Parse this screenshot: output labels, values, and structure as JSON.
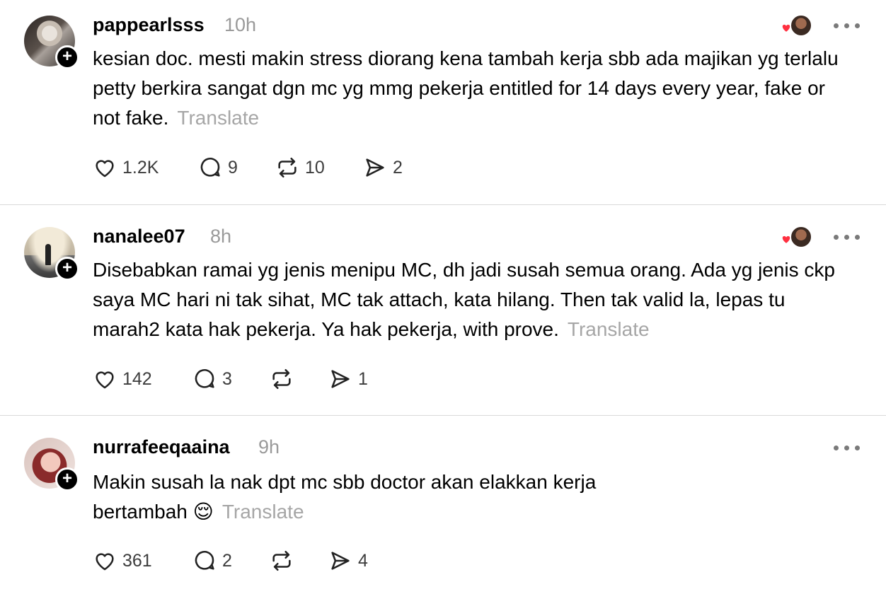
{
  "labels": {
    "translate": "Translate"
  },
  "colors": {
    "like_heart": "#ff3040",
    "divider": "#d9d9d9",
    "muted_text": "#9a9a9a"
  },
  "posts": [
    {
      "username": "pappearlsss",
      "time": "10h",
      "text": "kesian doc. mesti makin stress diorang kena tambah kerja sbb ada majikan yg terlalu petty berkira sangat dgn mc yg mmg pekerja entitled for 14 days every year, fake or not fake.",
      "likes": "1.2K",
      "replies": "9",
      "reposts": "10",
      "shares": "2",
      "creator_reacted": true
    },
    {
      "username": "nanalee07",
      "time": "8h",
      "text": "Disebabkan ramai yg jenis menipu MC, dh jadi susah semua orang. Ada yg jenis ckp saya MC hari ni tak sihat, MC tak attach, kata hilang. Then tak valid la, lepas tu marah2 kata hak pekerja. Ya hak pekerja, with prove.",
      "likes": "142",
      "replies": "3",
      "reposts": "",
      "shares": "1",
      "creator_reacted": true
    },
    {
      "username": "nurrafeeqaaina",
      "time": "9h",
      "text": "Makin susah la nak dpt mc sbb doctor akan elakkan kerja bertambah 😌",
      "likes": "361",
      "replies": "2",
      "reposts": "",
      "shares": "4",
      "creator_reacted": false
    }
  ]
}
